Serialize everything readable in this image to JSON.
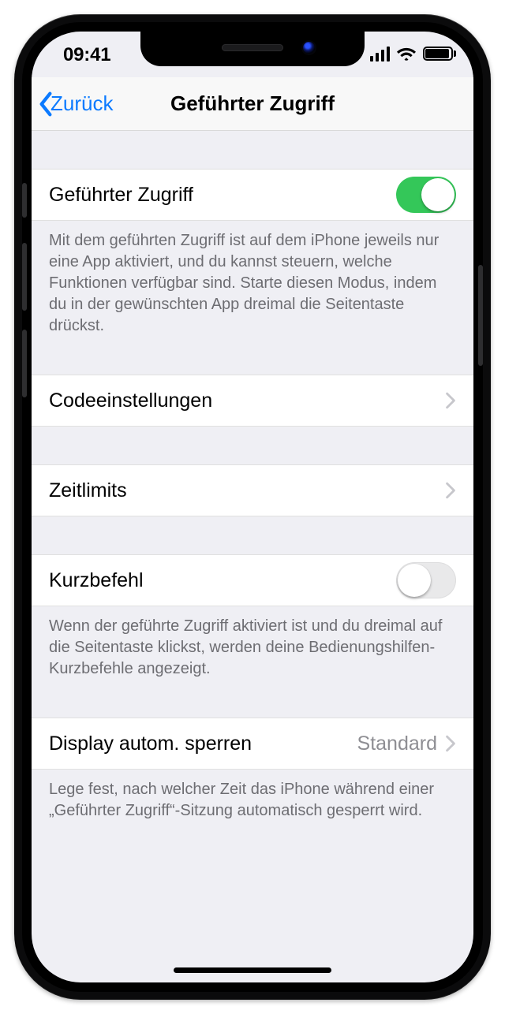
{
  "status": {
    "time": "09:41"
  },
  "nav": {
    "back_label": "Zurück",
    "title": "Geführter Zugriff"
  },
  "rows": {
    "main_toggle": {
      "label": "Geführter Zugriff",
      "on": true
    },
    "main_footer": "Mit dem geführten Zugriff ist auf dem iPhone jeweils nur eine App aktiviert, und du kannst steuern, welche Funktionen verfügbar sind. Starte diesen Modus, indem du in der gewünschten App dreimal die Seitentaste drückst.",
    "passcode": {
      "label": "Codeeinstellungen"
    },
    "timelimits": {
      "label": "Zeitlimits"
    },
    "shortcut": {
      "label": "Kurzbefehl",
      "on": false
    },
    "shortcut_footer": "Wenn der geführte Zugriff aktiviert ist und du dreimal auf die Seitentaste klickst, werden deine Bedienungshilfen-Kurzbefehle angezeigt.",
    "autolock": {
      "label": "Display autom. sperren",
      "value": "Standard"
    },
    "autolock_footer": "Lege fest, nach welcher Zeit das iPhone während einer „Geführter Zugriff“-Sitzung automatisch gesperrt wird."
  }
}
